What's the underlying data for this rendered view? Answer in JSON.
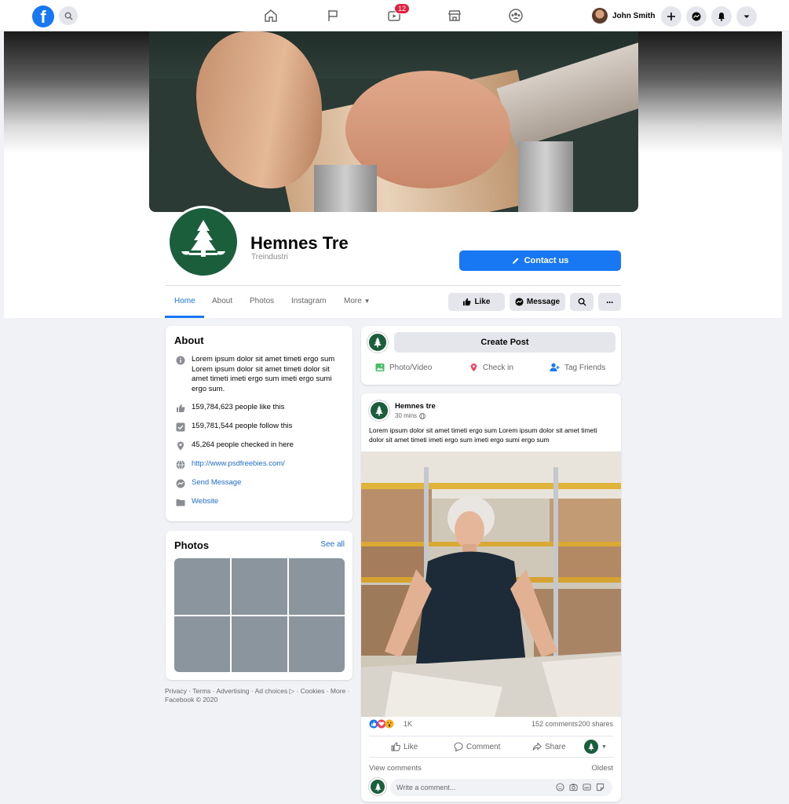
{
  "topnav": {
    "user_name": "John Smith",
    "watch_badge": "12"
  },
  "page": {
    "name": "Hemnes Tre",
    "category": "Treindustri",
    "contact_label": "Contact us"
  },
  "tabs": [
    {
      "label": "Home"
    },
    {
      "label": "About"
    },
    {
      "label": "Photos"
    },
    {
      "label": "Instagram"
    },
    {
      "label": "More"
    }
  ],
  "actions": {
    "like": "Like",
    "message": "Message"
  },
  "about": {
    "title": "About",
    "description": "Lorem ipsum dolor sit amet timeti ergo sum Lorem ipsum dolor sit amet timeti dolor sit amet timeti imeti ergo sum imeti ergo sumi ergo sum.",
    "likes": "159,784,623 people like this",
    "follows": "159,781,544 people follow this",
    "checkins": "45,264 people checked in here",
    "website_url": "http://www.psdfreebies.com/",
    "send_message": "Send Message",
    "website": "Website"
  },
  "photos": {
    "title": "Photos",
    "see_all": "See all"
  },
  "footer": "Privacy · Terms · Advertising · Ad choices ▷ · Cookies · More · Facebook © 2020",
  "create_post": {
    "button": "Create Post",
    "photo_video": "Photo/Video",
    "check_in": "Check in",
    "tag_friends": "Tag Friends"
  },
  "post": {
    "author": "Hemnes tre",
    "time": "30 mins",
    "text": "Lorem ipsum dolor sit amet timeti ergo sum Lorem ipsum dolor sit amet timeti dolor sit amet timeti imeti ergo sum imeti ergo sumi ergo sum",
    "reactions_count": "1K",
    "comments": "152 comments",
    "shares": "200 shares",
    "like": "Like",
    "comment": "Comment",
    "share": "Share",
    "view_comments": "View comments",
    "oldest": "Oldest",
    "comment_placeholder": "Write a comment..."
  },
  "colors": {
    "brand": "#1877f2",
    "logo_green": "#1b5e3c",
    "background": "#f0f2f5"
  }
}
